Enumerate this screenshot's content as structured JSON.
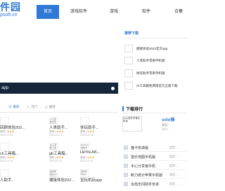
{
  "header": {
    "logo_line1": "件园",
    "logo_line2": "psoft.cn",
    "nav": [
      {
        "label": "首页",
        "active": true
      },
      {
        "label": "游戏软件",
        "active": false
      },
      {
        "label": "游戏",
        "active": false
      },
      {
        "label": "软件",
        "active": false
      },
      {
        "label": "合集",
        "active": false
      }
    ]
  },
  "hero": {
    "caption": "app"
  },
  "tabs": [
    {
      "label": "最新",
      "active": true
    },
    {
      "label": "热门",
      "active": false
    },
    {
      "label": "推荐",
      "active": false
    }
  ],
  "cards": [
    {
      "thumb": "",
      "title": "回顾体验202...",
      "type": "游戏",
      "stars": "★★★",
      "date": "2023-12-18"
    },
    {
      "thumb": "人人贵助手苹果手机版",
      "title": "人贵助手...",
      "type": "游戏",
      "stars": "★★★",
      "date": "2023-12-17"
    },
    {
      "thumb": "",
      "title": "休玩助手...",
      "type": "游戏",
      "stars": "★★★",
      "date": "2023-12-16"
    },
    {
      "thumb": "依玩助手苹果手机版",
      "title": "休玩助手...",
      "type": "游戏",
      "stars": "★★★",
      "date": "2023-12-15"
    },
    {
      "thumb": "",
      "title": "ck工具箱...",
      "type": "游戏",
      "stars": "★★★",
      "date": "2023-12-14"
    },
    {
      "thumb": "gb工具箱下载手机版",
      "title": "gb工具箱...",
      "type": "游戏",
      "stars": "★★★",
      "date": "2023-12-13"
    },
    {
      "thumb": "HeYoLAB吉他手机版",
      "title": "HeYoLAB...",
      "type": "游戏",
      "stars": "★★★",
      "date": "2023-12-12"
    },
    {
      "thumb": "",
      "title": "大家动...",
      "type": "游戏",
      "stars": "★★★",
      "date": "2023-12-11"
    },
    {
      "thumb": "",
      "title": "人助手...",
      "type": "游戏",
      "stars": "★★★",
      "date": "2023-12-10"
    },
    {
      "thumb": "捷接体验2024官网版",
      "title": "捷接体验202...",
      "type": "游戏",
      "stars": "★★★",
      "date": "2023-12-09"
    },
    {
      "thumb": "宝玩机玩app",
      "title": "宝玩机玩app...",
      "type": "游戏",
      "stars": "★★★",
      "date": "2023-12-08"
    },
    {
      "thumb": "",
      "title": "宝玩机玩app",
      "type": "游戏",
      "stars": "★★★",
      "date": "2023-12-07"
    }
  ],
  "sidebar": {
    "title": "推荐下载",
    "items": [
      {
        "label": "捷接体验2024官方app"
      },
      {
        "label": "人贵助手苹果手机版"
      },
      {
        "label": "依玩助手苹果手机版"
      },
      {
        "label": "ck工具箱免费版官方正版下载"
      }
    ]
  },
  "ranking": {
    "title": "下载排行",
    "top": {
      "thumb": "Solo插件苹果手机版",
      "logo": "solo插",
      "type": "类型：",
      "size": "大小："
    },
    "rows": [
      {
        "num": "2",
        "name": "猫卡安卓版",
        "type": "类型：..."
      },
      {
        "num": "3",
        "name": "猎乐地图手机版",
        "type": "类型：..."
      },
      {
        "num": "4",
        "name": "手心分享官手机",
        "type": "类型：..."
      },
      {
        "num": "5",
        "name": "断刀统计苹果手机版",
        "type": "类型：..."
      },
      {
        "num": "6",
        "name": "永劫无间助手安卓",
        "type": "类型：..."
      }
    ]
  },
  "colors": {
    "accent": "#2f78d6",
    "hero_bar": "#15263c"
  }
}
